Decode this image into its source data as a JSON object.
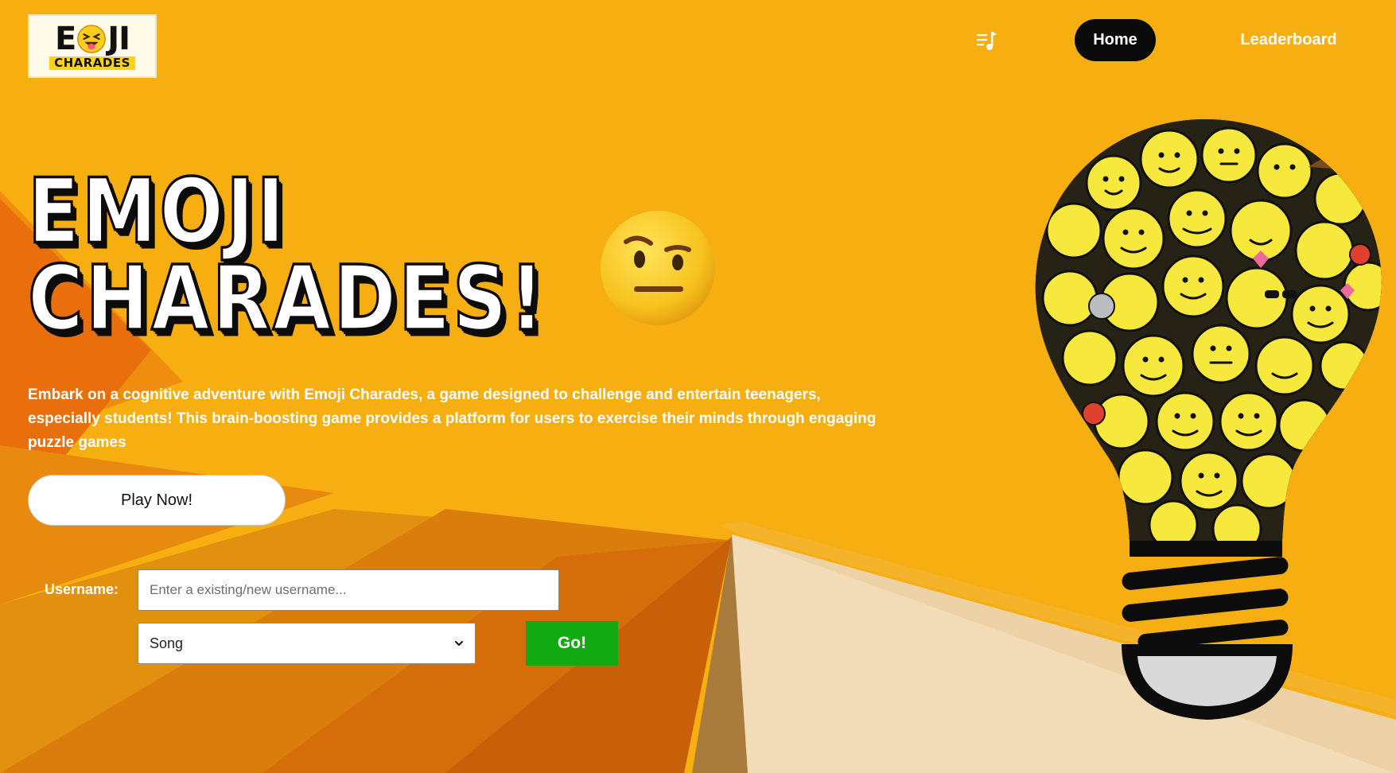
{
  "logo": {
    "line1_left": "E",
    "line1_right": "JI",
    "line2": "CHARADES"
  },
  "nav": {
    "music_icon": "music-playlist-icon",
    "home_label": "Home",
    "leaderboard_label": "Leaderboard"
  },
  "hero": {
    "title_line1": "EMOJI",
    "title_line2": "CHARADES!",
    "title_emoji": "raised-eyebrow-face-emoji",
    "description": "Embark on a cognitive adventure with Emoji Charades, a game designed to challenge and entertain teenagers, especially students! This brain-boosting game provides a platform for users to exercise their minds through engaging puzzle games"
  },
  "actions": {
    "play_label": "Play Now!",
    "go_label": "Go!"
  },
  "form": {
    "username_label": "Username:",
    "username_placeholder": "Enter a existing/new username...",
    "username_value": "",
    "category_selected": "Song"
  },
  "illustration": {
    "name": "lightbulb-of-emojis"
  },
  "colors": {
    "background": "#f6ae10",
    "home_pill": "#0a0a0a",
    "go_button": "#12aa12",
    "text_light": "#ffffff"
  }
}
